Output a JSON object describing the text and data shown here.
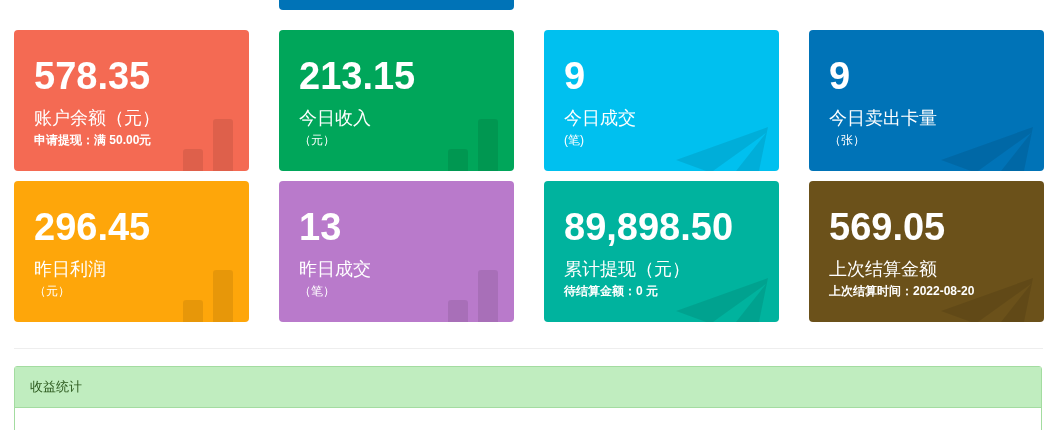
{
  "cards": [
    {
      "value": "578.35",
      "label": "账户余额（元）",
      "note": "申请提现：满 50.00元",
      "emphasis": true,
      "color": "#f46a53",
      "kind": "bars"
    },
    {
      "value": "213.15",
      "label": "今日收入",
      "note": "（元）",
      "emphasis": false,
      "color": "#00a65a",
      "kind": "bars"
    },
    {
      "value": "9",
      "label": "今日成交",
      "note": "(笔)",
      "emphasis": false,
      "color": "#00c0ef",
      "kind": "plane"
    },
    {
      "value": "9",
      "label": "今日卖出卡量",
      "note": "（张）",
      "emphasis": false,
      "color": "#0073b7",
      "kind": "plane"
    },
    {
      "value": "296.45",
      "label": "昨日利润",
      "note": "（元）",
      "emphasis": false,
      "color": "#fea60a",
      "kind": "bars"
    },
    {
      "value": "13",
      "label": "昨日成交",
      "note": "（笔）",
      "emphasis": false,
      "color": "#b97acb",
      "kind": "bars"
    },
    {
      "value": "89,898.50",
      "label": "累计提现（元）",
      "note": "待结算金额：0 元",
      "emphasis": true,
      "color": "#00b39e",
      "kind": "plane"
    },
    {
      "value": "569.05",
      "label": "上次结算金额",
      "note": "上次结算时间：2022-08-20",
      "emphasis": true,
      "color": "#6b511a",
      "kind": "plane"
    }
  ],
  "panel": {
    "title": "收益统计"
  }
}
